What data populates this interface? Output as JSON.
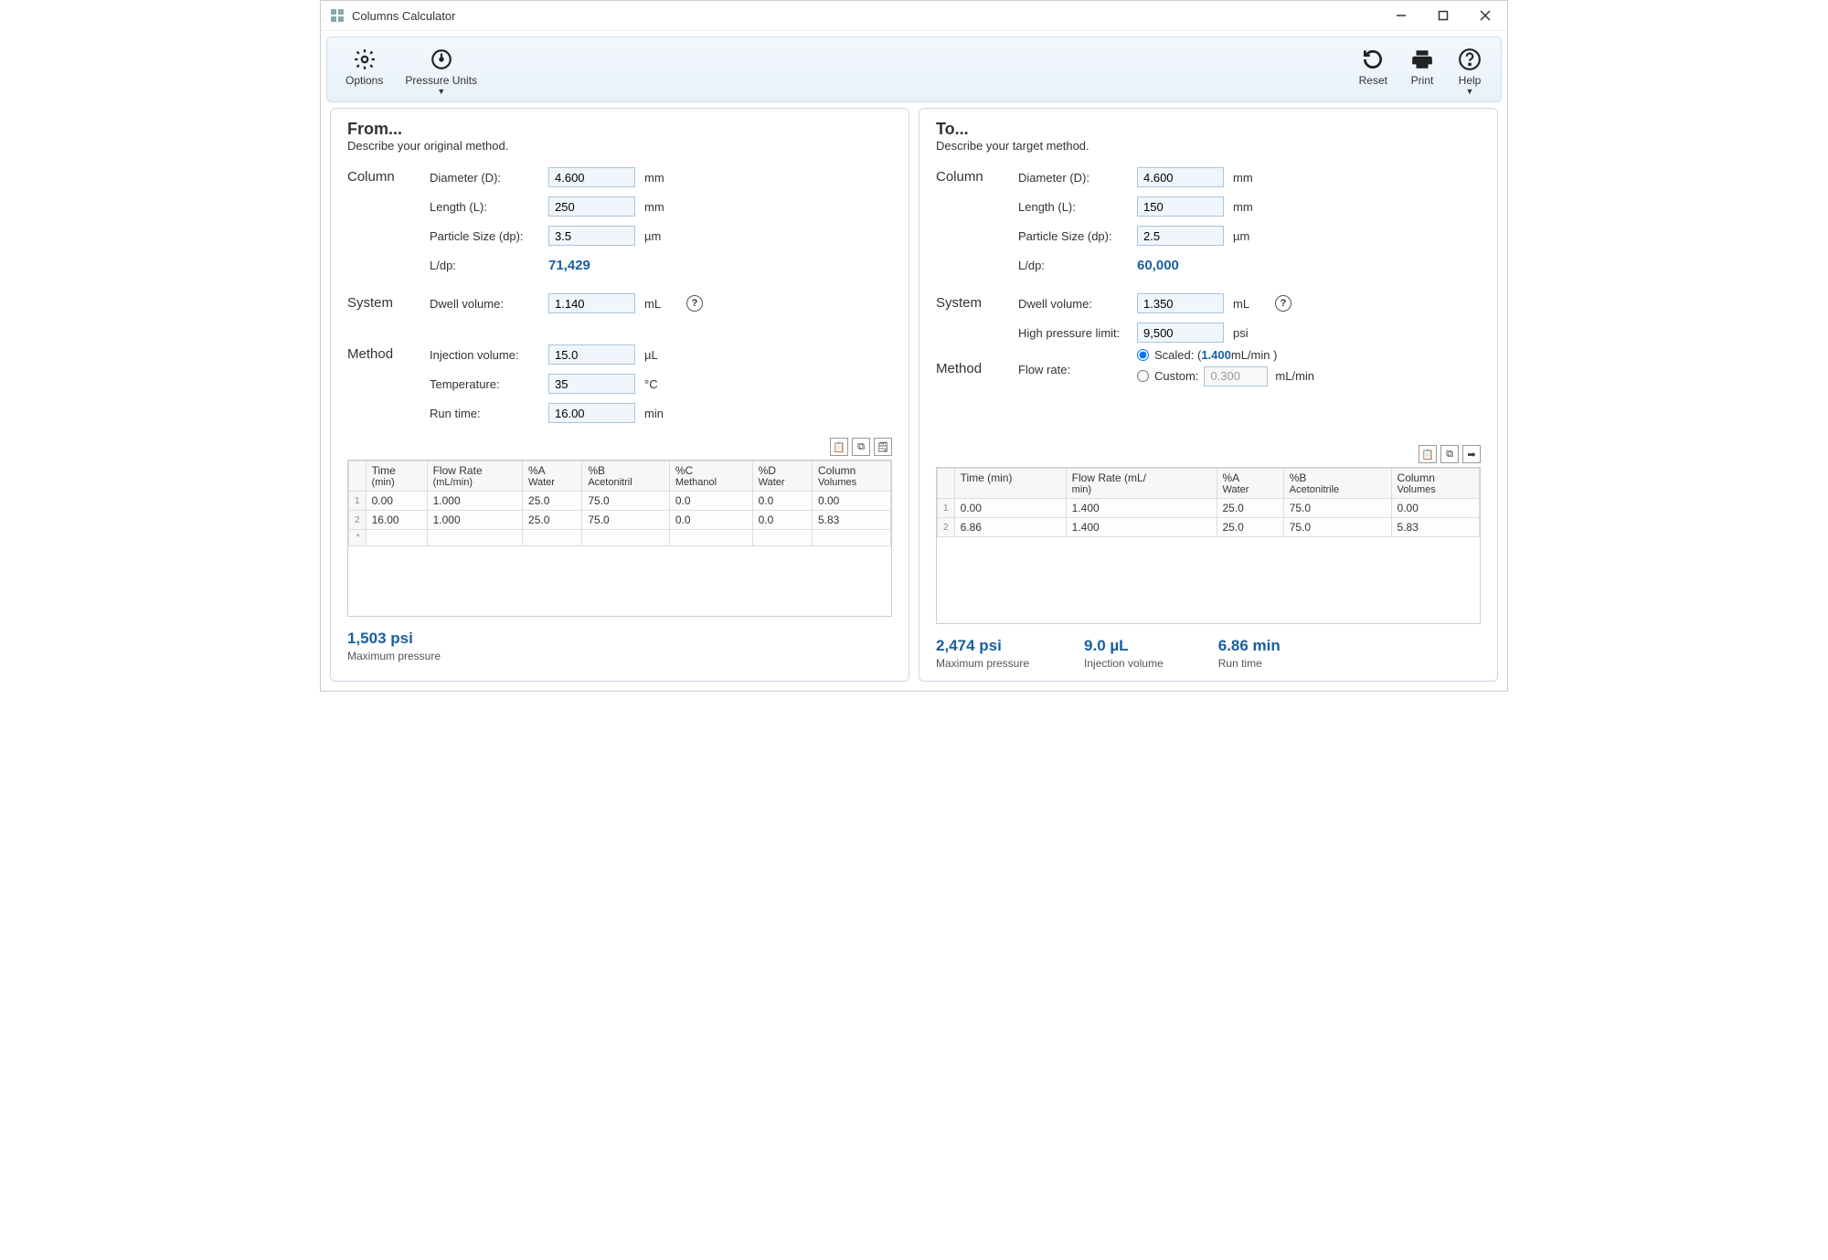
{
  "window": {
    "title": "Columns Calculator"
  },
  "toolbar": {
    "options": "Options",
    "pressure_units": "Pressure Units",
    "reset": "Reset",
    "print": "Print",
    "help": "Help"
  },
  "from": {
    "title": "From...",
    "subtitle": "Describe your original method.",
    "column_label": "Column",
    "diameter_label": "Diameter (D):",
    "diameter": "4.600",
    "diameter_unit": "mm",
    "length_label": "Length (L):",
    "length": "250",
    "length_unit": "mm",
    "particle_label": "Particle Size (dp):",
    "particle": "3.5",
    "particle_unit": "µm",
    "ldp_label": "L/dp:",
    "ldp": "71,429",
    "system_label": "System",
    "dwell_label": "Dwell volume:",
    "dwell": "1.140",
    "dwell_unit": "mL",
    "method_label": "Method",
    "inj_label": "Injection volume:",
    "inj": "15.0",
    "inj_unit": "µL",
    "temp_label": "Temperature:",
    "temp": "35",
    "temp_unit": "°C",
    "run_label": "Run time:",
    "run": "16.00",
    "run_unit": "min",
    "headers": {
      "time": "Time",
      "time_sub": "(min)",
      "flow": "Flow Rate",
      "flow_sub": "(mL/min)",
      "a": "%A",
      "a_sub": "Water",
      "b": "%B",
      "b_sub": "Acetonitril",
      "c": "%C",
      "c_sub": "Methanol",
      "d": "%D",
      "d_sub": "Water",
      "cv": "Column",
      "cv_sub": "Volumes"
    },
    "rows": [
      {
        "n": "1",
        "time": "0.00",
        "flow": "1.000",
        "a": "25.0",
        "b": "75.0",
        "c": "0.0",
        "d": "0.0",
        "cv": "0.00"
      },
      {
        "n": "2",
        "time": "16.00",
        "flow": "1.000",
        "a": "25.0",
        "b": "75.0",
        "c": "0.0",
        "d": "0.0",
        "cv": "5.83"
      },
      {
        "n": "*",
        "time": "",
        "flow": "",
        "a": "",
        "b": "",
        "c": "",
        "d": "",
        "cv": ""
      }
    ],
    "summary_pressure": "1,503 psi",
    "summary_pressure_label": "Maximum pressure"
  },
  "to": {
    "title": "To...",
    "subtitle": "Describe your target method.",
    "column_label": "Column",
    "diameter_label": "Diameter (D):",
    "diameter": "4.600",
    "diameter_unit": "mm",
    "length_label": "Length (L):",
    "length": "150",
    "length_unit": "mm",
    "particle_label": "Particle Size (dp):",
    "particle": "2.5",
    "particle_unit": "µm",
    "ldp_label": "L/dp:",
    "ldp": "60,000",
    "system_label": "System",
    "dwell_label": "Dwell volume:",
    "dwell": "1.350",
    "dwell_unit": "mL",
    "hpl_label": "High pressure limit:",
    "hpl": "9,500",
    "hpl_unit": "psi",
    "method_label": "Method",
    "flow_label": "Flow rate:",
    "scaled_label": "Scaled: (",
    "scaled_value": " 1.400 ",
    "scaled_unit": "mL/min )",
    "custom_label": "Custom:",
    "custom_value": "0.300",
    "custom_unit": "mL/min",
    "headers": {
      "time": "Time (min)",
      "flow": "Flow Rate (mL/",
      "flow_sub": "min)",
      "a": "%A",
      "a_sub": "Water",
      "b": "%B",
      "b_sub": "Acetonitrile",
      "cv": "Column",
      "cv_sub": "Volumes"
    },
    "rows": [
      {
        "n": "1",
        "time": "0.00",
        "flow": "1.400",
        "a": "25.0",
        "b": "75.0",
        "cv": "0.00"
      },
      {
        "n": "2",
        "time": "6.86",
        "flow": "1.400",
        "a": "25.0",
        "b": "75.0",
        "cv": "5.83"
      }
    ],
    "summary_pressure": "2,474 psi",
    "summary_pressure_label": "Maximum pressure",
    "summary_inj": "9.0  µL",
    "summary_inj_label": "Injection volume",
    "summary_run": "6.86  min",
    "summary_run_label": "Run time"
  }
}
